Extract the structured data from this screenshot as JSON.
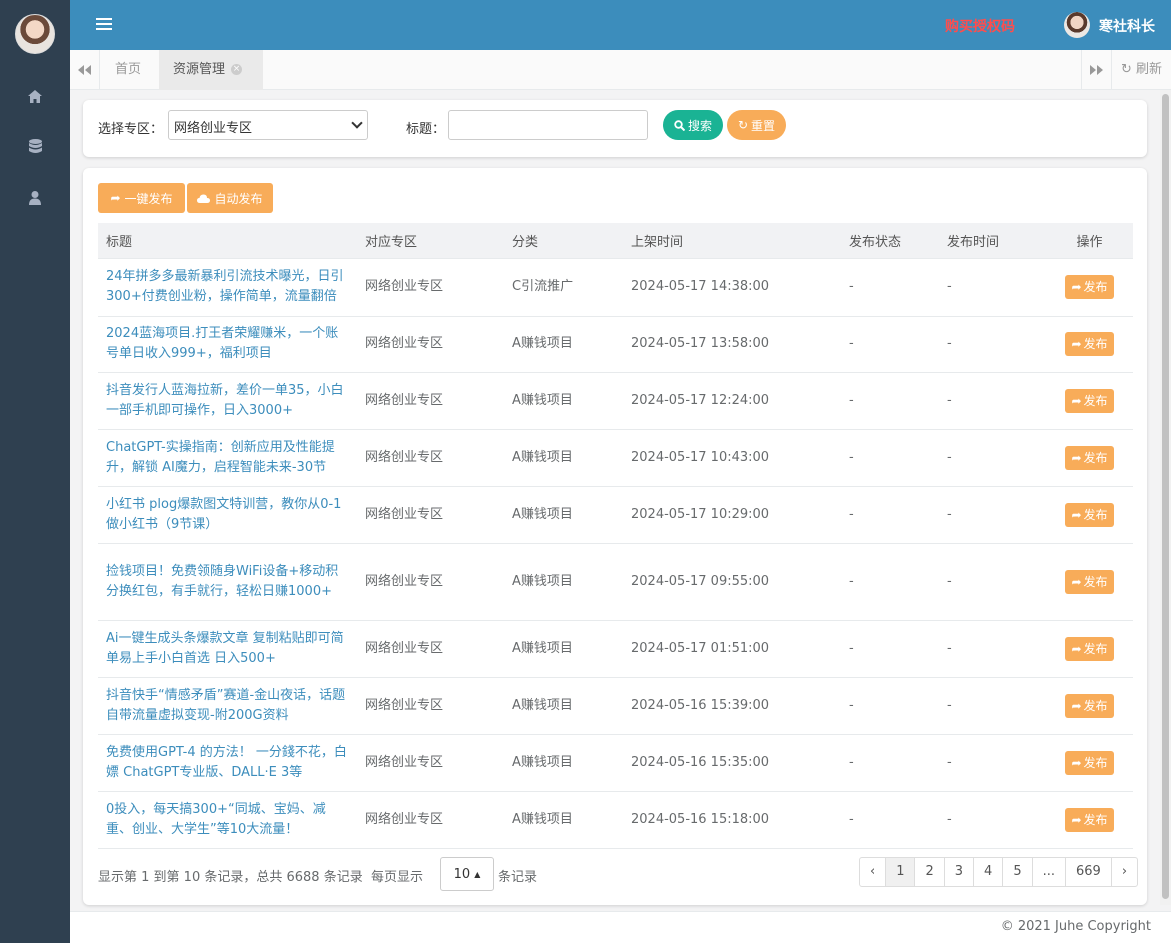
{
  "colors": {
    "sidebar": "#2f4050",
    "topbar": "#3c8dbc",
    "accent_green": "#1ab394",
    "accent_orange": "#f8ac59",
    "link_blue": "#3c8dbc",
    "buy_red": "#ff4d4d"
  },
  "topbar": {
    "buy_link": "购买授权码",
    "user_name": "寒社科长",
    "menu_icon": "hamburger-icon"
  },
  "sidebar": {
    "items": [
      {
        "icon": "home-icon"
      },
      {
        "icon": "database-icon"
      },
      {
        "icon": "user-icon"
      }
    ]
  },
  "tabs": {
    "items": [
      {
        "label": "首页"
      },
      {
        "label": "资源管理",
        "active": true
      }
    ],
    "refresh_label": "刷新"
  },
  "search": {
    "zone_label": "选择专区：",
    "zone_value": "网络创业专区",
    "title_label": "标题：",
    "title_value": "",
    "search_label": "搜索",
    "reset_label": "重置"
  },
  "toolbar": {
    "one_click_label": "一键发布",
    "auto_label": "自动发布"
  },
  "table": {
    "headers": [
      "标题",
      "对应专区",
      "分类",
      "上架时间",
      "发布状态",
      "发布时间",
      "操作"
    ],
    "rows": [
      {
        "title": "24年拼多多最新暴利引流技术曝光，日引300+付费创业粉，操作简单，流量翻倍",
        "zone": "网络创业专区",
        "category": "C引流推广",
        "time": "2024-05-17 14:38:00",
        "status": "-",
        "pub_time": "-",
        "action": "发布"
      },
      {
        "title": "2024蓝海项目.打王者荣耀赚米，一个账号单日收入999+，福利项目",
        "zone": "网络创业专区",
        "category": "A赚钱项目",
        "time": "2024-05-17 13:58:00",
        "status": "-",
        "pub_time": "-",
        "action": "发布"
      },
      {
        "title": "抖音发行人蓝海拉新，差价一单35，小白一部手机即可操作，日入3000+",
        "zone": "网络创业专区",
        "category": "A赚钱项目",
        "time": "2024-05-17 12:24:00",
        "status": "-",
        "pub_time": "-",
        "action": "发布"
      },
      {
        "title": "ChatGPT-实操指南：创新应用及性能提升，解锁 AI魔力，启程智能未来-30节",
        "zone": "网络创业专区",
        "category": "A赚钱项目",
        "time": "2024-05-17 10:43:00",
        "status": "-",
        "pub_time": "-",
        "action": "发布"
      },
      {
        "title": "小红书 plog爆款图文特训营，教你从0-1做小红书（9节课）",
        "zone": "网络创业专区",
        "category": "A赚钱项目",
        "time": "2024-05-17 10:29:00",
        "status": "-",
        "pub_time": "-",
        "action": "发布"
      },
      {
        "title": "捡钱项目！免费领随身WiFi设备+移动积分换红包，有手就行，轻松日赚1000+",
        "zone": "网络创业专区",
        "category": "A赚钱项目",
        "time": "2024-05-17 09:55:00",
        "status": "-",
        "pub_time": "-",
        "action": "发布"
      },
      {
        "title": "Ai一键生成头条爆款文章 复制粘贴即可简单易上手小白首选 日入500+",
        "zone": "网络创业专区",
        "category": "A赚钱项目",
        "time": "2024-05-17 01:51:00",
        "status": "-",
        "pub_time": "-",
        "action": "发布"
      },
      {
        "title": "抖音快手“情感矛盾”赛道-金山夜话，话题自带流量虚拟变现-附200G资料",
        "zone": "网络创业专区",
        "category": "A赚钱项目",
        "time": "2024-05-16 15:39:00",
        "status": "-",
        "pub_time": "-",
        "action": "发布"
      },
      {
        "title": "免费使用GPT-4 的方法！ 一分錢不花，白嫖 ChatGPT专业版、DALL·E 3等",
        "zone": "网络创业专区",
        "category": "A赚钱项目",
        "time": "2024-05-16 15:35:00",
        "status": "-",
        "pub_time": "-",
        "action": "发布"
      },
      {
        "title": "0投入，每天搞300+“同城、宝妈、减重、创业、大学生”等10大流量！",
        "zone": "网络创业专区",
        "category": "A赚钱项目",
        "time": "2024-05-16 15:18:00",
        "status": "-",
        "pub_time": "-",
        "action": "发布"
      }
    ]
  },
  "pagination": {
    "info": "显示第 1 到第 10 条记录，总共 6688 条记录",
    "per_page_prefix": "每页显示",
    "per_page_value": "10",
    "per_page_suffix": "条记录",
    "pages": [
      "‹",
      "1",
      "2",
      "3",
      "4",
      "5",
      "...",
      "669",
      "›"
    ],
    "active_page": "1"
  },
  "footer": {
    "copyright": "© 2021 Juhe Copyright"
  }
}
